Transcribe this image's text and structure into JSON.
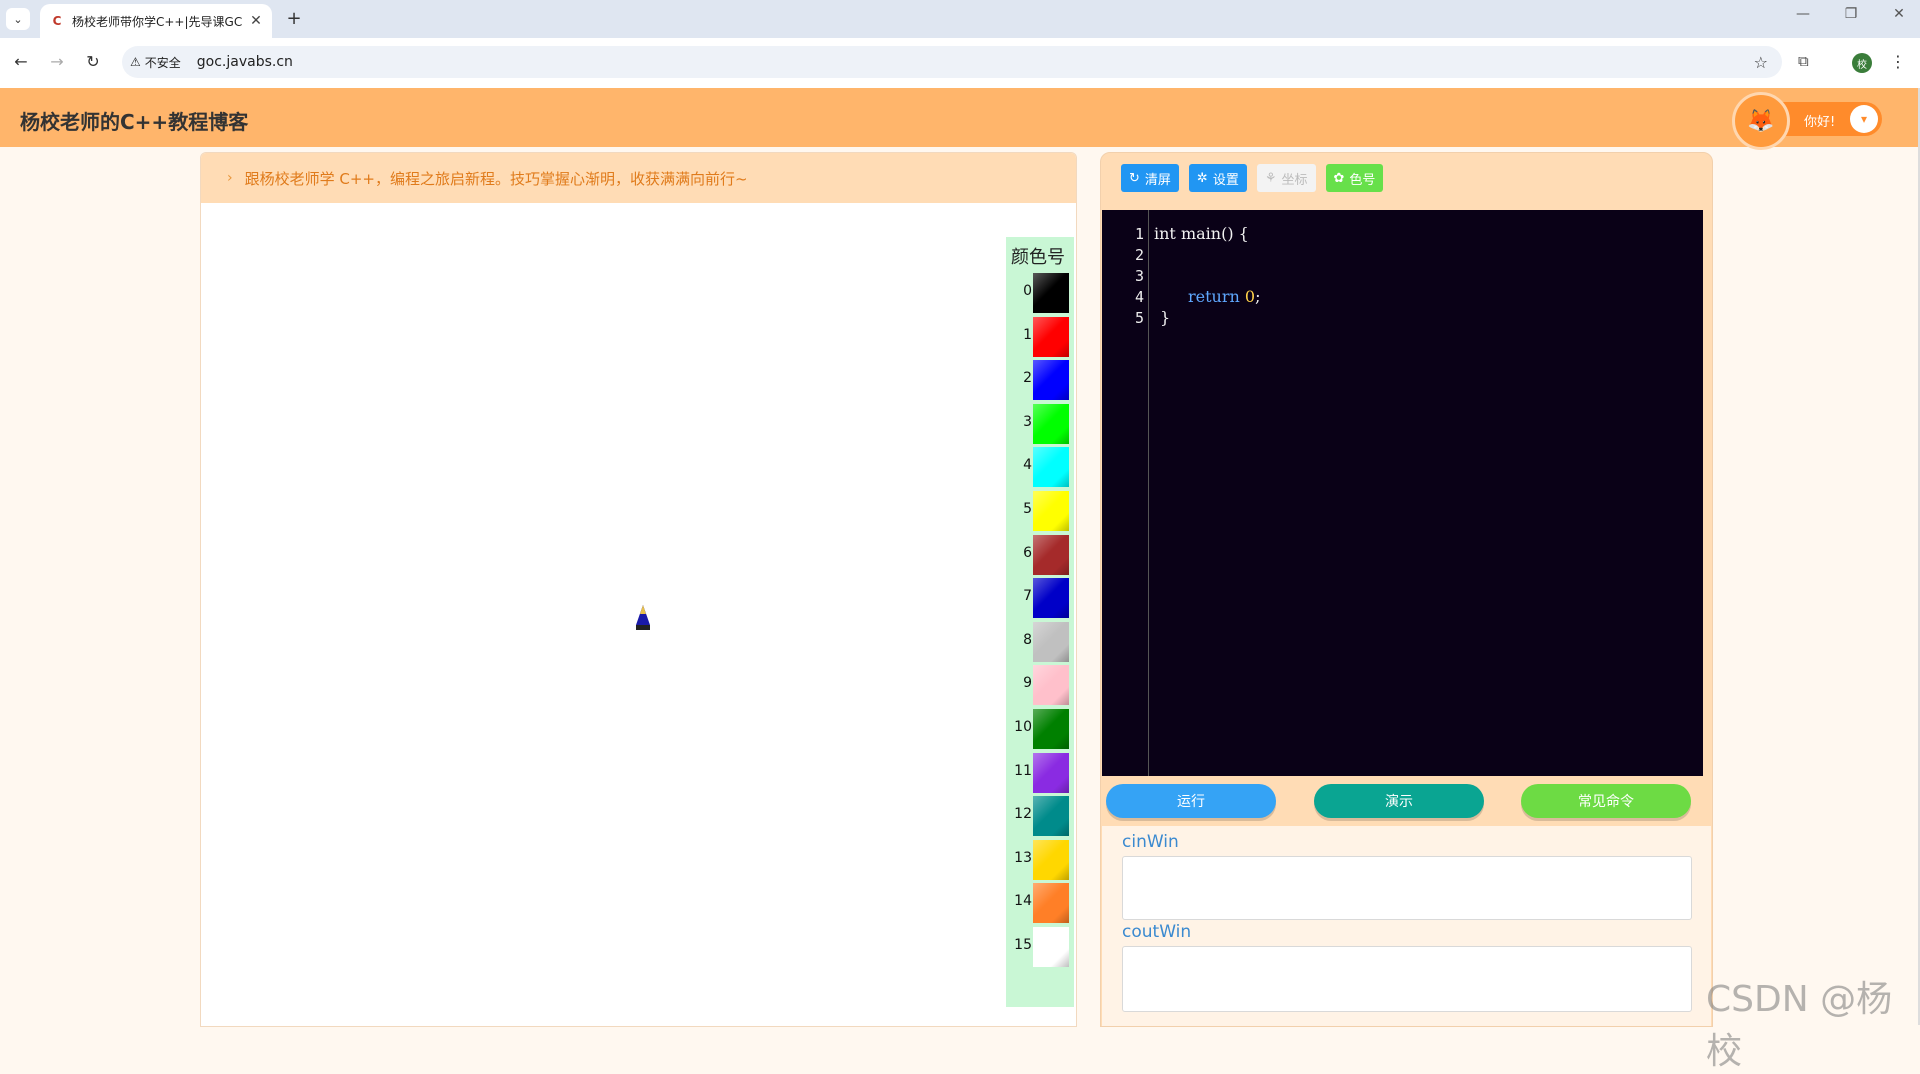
{
  "browser": {
    "tab_title": "杨校老师带你学C++|先导课GC",
    "tab_favicon": "C",
    "tab_close": "✕",
    "new_tab": "+",
    "insecure_label": "不安全",
    "url": "goc.javabs.cn",
    "profile_initial": "校",
    "window_minimize": "—",
    "window_restore": "❐",
    "window_close": "✕"
  },
  "header": {
    "site_title": "杨校老师的C++教程博客",
    "greeting": "你好!"
  },
  "notice": {
    "text": "跟杨校老师学 C++，编程之旅启新程。技巧掌握心渐明，收获满满向前行~"
  },
  "palette": {
    "title": "颜色号",
    "colors": [
      {
        "num": "0",
        "color": "#000000"
      },
      {
        "num": "1",
        "color": "#ff0000"
      },
      {
        "num": "2",
        "color": "#0000ff"
      },
      {
        "num": "3",
        "color": "#00ff00"
      },
      {
        "num": "4",
        "color": "#00ffff"
      },
      {
        "num": "5",
        "color": "#ffff00"
      },
      {
        "num": "6",
        "color": "#a52a2a"
      },
      {
        "num": "7",
        "color": "#0000c8"
      },
      {
        "num": "8",
        "color": "#c0c0c0"
      },
      {
        "num": "9",
        "color": "#ffc0cb"
      },
      {
        "num": "10",
        "color": "#008000"
      },
      {
        "num": "11",
        "color": "#8a2be2"
      },
      {
        "num": "12",
        "color": "#008b8b"
      },
      {
        "num": "13",
        "color": "#ffd700"
      },
      {
        "num": "14",
        "color": "#ff7f27"
      },
      {
        "num": "15",
        "color": "#ffffff"
      }
    ]
  },
  "toolbar": {
    "clear_label": "清屏",
    "settings_label": "设置",
    "coords_label": "坐标",
    "colors_label": "色号",
    "clear_color": "#2196f3",
    "settings_color": "#2196f3",
    "coords_color": "#f3f3f3",
    "colors_color": "#67e04a"
  },
  "editor": {
    "line_numbers": [
      "1",
      "2",
      "3",
      "4",
      "5"
    ],
    "line1": "int main() {",
    "line4_kw": "return",
    "line4_num": "0",
    "line4_end": ";",
    "line5": "}"
  },
  "run_buttons": {
    "run_label": "运行",
    "demo_label": "演示",
    "commands_label": "常见命令",
    "run_color": "#35a3f5",
    "demo_color": "#0aa592",
    "commands_color": "#6ddb44"
  },
  "io": {
    "cin_label": "cinWin",
    "cout_label": "coutWin"
  },
  "watermark": "CSDN @杨校"
}
